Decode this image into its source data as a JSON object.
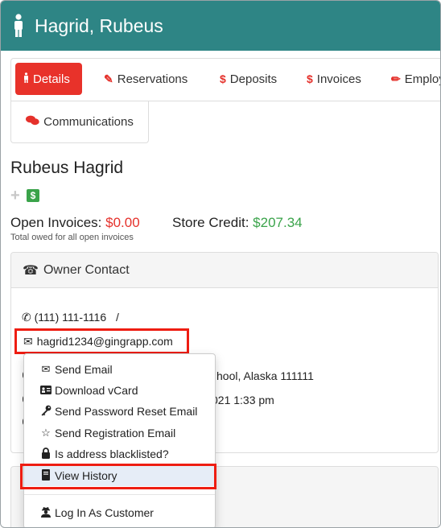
{
  "header": {
    "title": "Hagrid, Rubeus"
  },
  "tabs": [
    {
      "label": "Details",
      "icon": "person-icon",
      "active": true
    },
    {
      "label": "Reservations",
      "icon": "edit-icon",
      "active": false
    },
    {
      "label": "Deposits",
      "icon": "dollar-icon",
      "active": false
    },
    {
      "label": "Invoices",
      "icon": "dollar-icon",
      "active": false
    },
    {
      "label": "Employ",
      "icon": "pencil-icon",
      "active": false
    },
    {
      "label": "Communications",
      "icon": "comments-icon",
      "active": false
    }
  ],
  "owner": {
    "name": "Rubeus Hagrid",
    "open_invoices_label": "Open Invoices:",
    "open_invoices_value": "$0.00",
    "store_credit_label": "Store Credit:",
    "store_credit_value": "$207.34",
    "open_invoices_note": "Total owed for all open invoices"
  },
  "contact": {
    "header": "Owner Contact",
    "phone": "(111) 111-1116",
    "phone_sep": "/",
    "email": "hagrid1234@gingrapp.com",
    "address_partial": "hool, Alaska 111111",
    "date_partial": "021 1:33 pm"
  },
  "email_menu": {
    "items": [
      {
        "label": "Send Email",
        "icon": "envelope-icon"
      },
      {
        "label": "Download vCard",
        "icon": "vcard-icon"
      },
      {
        "label": "Send Password Reset Email",
        "icon": "key-icon"
      },
      {
        "label": "Send Registration Email",
        "icon": "star-icon"
      },
      {
        "label": "Is address blacklisted?",
        "icon": "lock-icon"
      },
      {
        "label": "View History",
        "icon": "book-icon",
        "highlighted": true
      },
      {
        "label": "Log In As Customer",
        "icon": "user-secret-icon"
      }
    ]
  },
  "colors": {
    "header_bg": "#2e8585",
    "active_tab": "#e8322a",
    "negative": "#e5312b",
    "positive": "#3aa34a",
    "callout": "#ee1d12"
  }
}
